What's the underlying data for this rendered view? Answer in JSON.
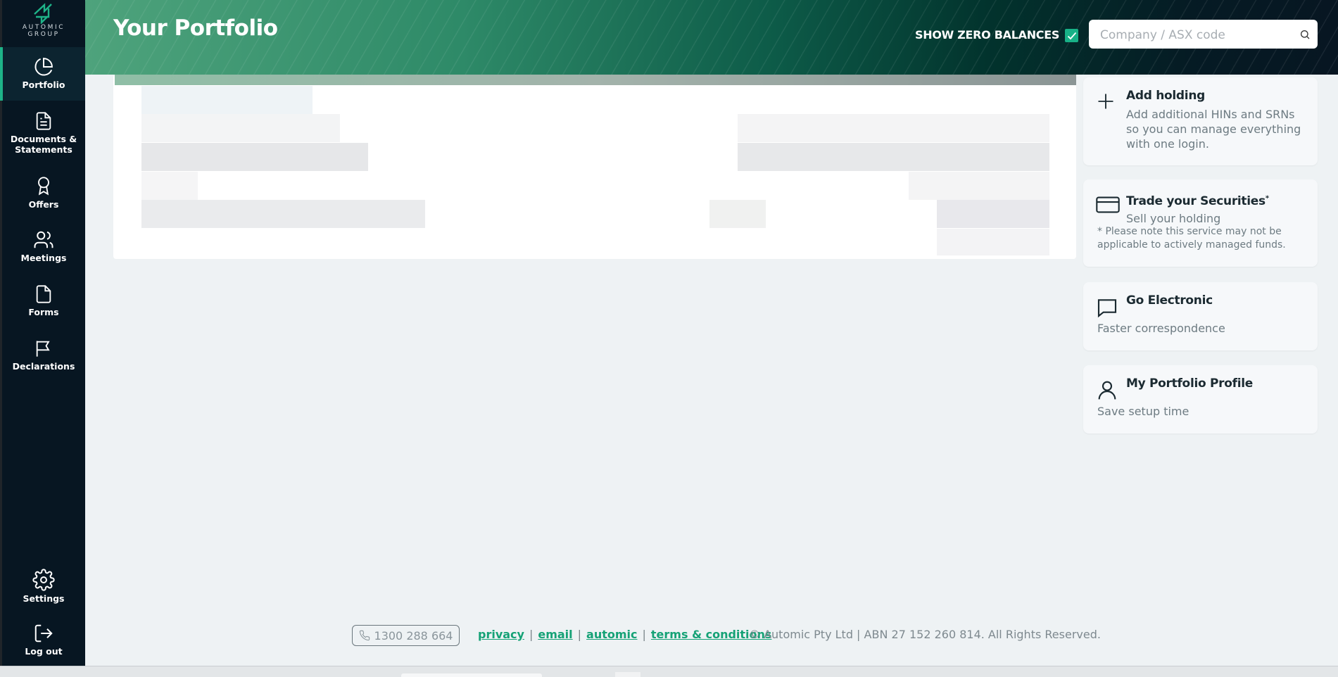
{
  "brand": {
    "logo_line1": "AUTOMIC",
    "logo_line2": "GROUP",
    "accent_color": "#1eb388"
  },
  "sidebar": {
    "items": [
      {
        "label": "Portfolio",
        "icon": "pie-chart-icon",
        "active": true
      },
      {
        "label": "Documents &",
        "label2": "Statements",
        "icon": "document-icon"
      },
      {
        "label": "Offers",
        "icon": "award-icon"
      },
      {
        "label": "Meetings",
        "icon": "users-icon"
      },
      {
        "label": "Forms",
        "icon": "file-icon"
      },
      {
        "label": "Declarations",
        "icon": "flag-icon"
      }
    ],
    "bottom_items": [
      {
        "label": "Settings",
        "icon": "gear-icon"
      },
      {
        "label": "Log out",
        "icon": "logout-icon"
      }
    ]
  },
  "header": {
    "title": "Your Portfolio",
    "zero_balances_label": "SHOW ZERO BALANCES",
    "zero_balances_checked": true,
    "search_placeholder": "Company / ASX code"
  },
  "cards": [
    {
      "icon": "plus-icon",
      "title": "Add holding",
      "desc_lines": [
        "Add additional HINs and SRNs",
        "so you can manage everything",
        "with one login."
      ]
    },
    {
      "icon": "credit-card-icon",
      "title": "Trade your Securities",
      "title_sup": "*",
      "desc": "Sell your holding",
      "note_lines": [
        "* Please note this service may not be",
        "applicable to actively managed funds."
      ]
    },
    {
      "icon": "chat-icon",
      "title": "Go Electronic",
      "desc": "Faster correspondence"
    },
    {
      "icon": "user-icon",
      "title": "My Portfolio Profile",
      "desc": "Save setup time"
    }
  ],
  "footer": {
    "phone": "1300 288 664",
    "links": [
      "privacy",
      "email",
      "automic",
      "terms & conditions"
    ],
    "separator": "|",
    "copyright": "© Automic Pty Ltd | ABN 27 152 260 814. All Rights Reserved."
  }
}
